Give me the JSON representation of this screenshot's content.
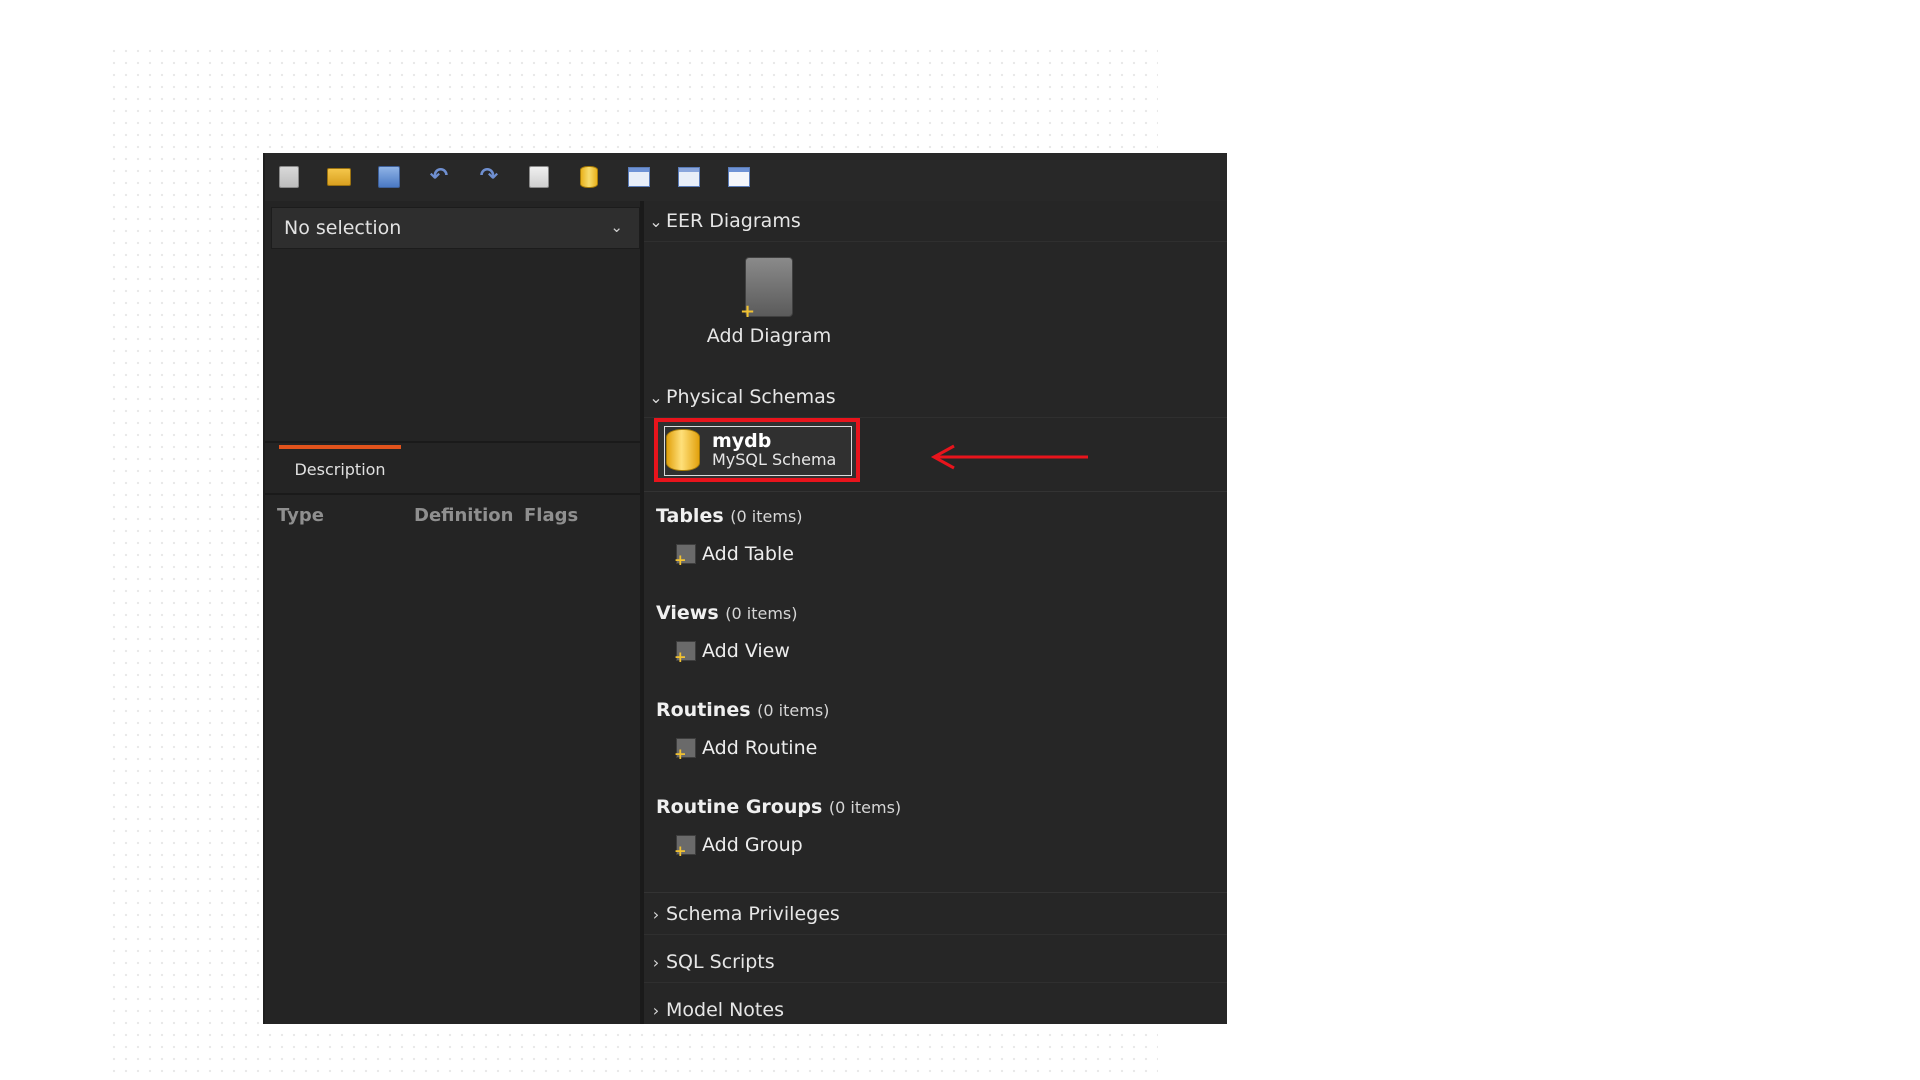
{
  "toolbar": {
    "buttons": [
      {
        "name": "new-document-icon"
      },
      {
        "name": "open-folder-icon"
      },
      {
        "name": "save-icon"
      },
      {
        "name": "undo-icon"
      },
      {
        "name": "redo-icon"
      },
      {
        "name": "new-diagram-icon"
      },
      {
        "name": "add-schema-icon"
      },
      {
        "name": "add-table-icon"
      },
      {
        "name": "add-view-icon"
      },
      {
        "name": "add-routine-icon"
      }
    ]
  },
  "left_panel": {
    "selector_value": "No selection",
    "tab_description": "Description",
    "columns": [
      "Type",
      "Definition",
      "Flags"
    ]
  },
  "right_panel": {
    "eer_section": "EER Diagrams",
    "add_diagram": "Add Diagram",
    "physical_section": "Physical Schemas",
    "schema": {
      "name": "mydb",
      "type": "MySQL Schema"
    },
    "groups": [
      {
        "title": "Tables",
        "count": "(0 items)",
        "action": "Add Table"
      },
      {
        "title": "Views",
        "count": "(0 items)",
        "action": "Add View"
      },
      {
        "title": "Routines",
        "count": "(0 items)",
        "action": "Add Routine"
      },
      {
        "title": "Routine Groups",
        "count": "(0 items)",
        "action": "Add Group"
      }
    ],
    "collapsed_sections": [
      "Schema Privileges",
      "SQL Scripts",
      "Model Notes"
    ]
  },
  "annotation": {
    "highlight_color": "#e8141c",
    "arrow_color": "#e8141c"
  }
}
